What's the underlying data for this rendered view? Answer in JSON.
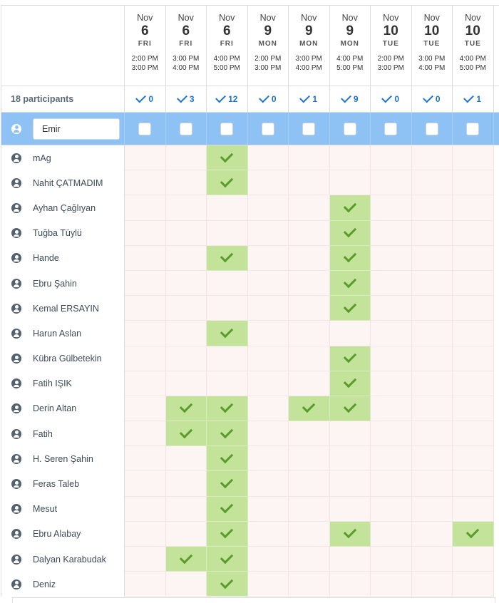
{
  "participants_label": "18 participants",
  "input": {
    "value": "Emir"
  },
  "slots": [
    {
      "month": "Nov",
      "day": "6",
      "dow": "FRI",
      "start": "2:00 PM",
      "end": "3:00 PM",
      "count": "0"
    },
    {
      "month": "Nov",
      "day": "6",
      "dow": "FRI",
      "start": "3:00 PM",
      "end": "4:00 PM",
      "count": "3"
    },
    {
      "month": "Nov",
      "day": "6",
      "dow": "FRI",
      "start": "4:00 PM",
      "end": "5:00 PM",
      "count": "12"
    },
    {
      "month": "Nov",
      "day": "9",
      "dow": "MON",
      "start": "2:00 PM",
      "end": "3:00 PM",
      "count": "0"
    },
    {
      "month": "Nov",
      "day": "9",
      "dow": "MON",
      "start": "3:00 PM",
      "end": "4:00 PM",
      "count": "1"
    },
    {
      "month": "Nov",
      "day": "9",
      "dow": "MON",
      "start": "4:00 PM",
      "end": "5:00 PM",
      "count": "9"
    },
    {
      "month": "Nov",
      "day": "10",
      "dow": "TUE",
      "start": "2:00 PM",
      "end": "3:00 PM",
      "count": "0"
    },
    {
      "month": "Nov",
      "day": "10",
      "dow": "TUE",
      "start": "3:00 PM",
      "end": "4:00 PM",
      "count": "0"
    },
    {
      "month": "Nov",
      "day": "10",
      "dow": "TUE",
      "start": "4:00 PM",
      "end": "5:00 PM",
      "count": "1"
    }
  ],
  "participants": [
    {
      "name": "mAg",
      "votes": [
        0,
        0,
        1,
        0,
        0,
        0,
        0,
        0,
        0
      ]
    },
    {
      "name": "Nahit ÇATMADIM",
      "votes": [
        0,
        0,
        1,
        0,
        0,
        0,
        0,
        0,
        0
      ]
    },
    {
      "name": "Ayhan Çağlıyan",
      "votes": [
        0,
        0,
        0,
        0,
        0,
        1,
        0,
        0,
        0
      ]
    },
    {
      "name": "Tuğba Tüylü",
      "votes": [
        0,
        0,
        0,
        0,
        0,
        1,
        0,
        0,
        0
      ]
    },
    {
      "name": "Hande",
      "votes": [
        0,
        0,
        1,
        0,
        0,
        1,
        0,
        0,
        0
      ]
    },
    {
      "name": "Ebru Şahin",
      "votes": [
        0,
        0,
        0,
        0,
        0,
        1,
        0,
        0,
        0
      ]
    },
    {
      "name": "Kemal ERSAYIN",
      "votes": [
        0,
        0,
        0,
        0,
        0,
        1,
        0,
        0,
        0
      ]
    },
    {
      "name": "Harun Aslan",
      "votes": [
        0,
        0,
        1,
        0,
        0,
        0,
        0,
        0,
        0
      ]
    },
    {
      "name": "Kübra Gülbetekin",
      "votes": [
        0,
        0,
        0,
        0,
        0,
        1,
        0,
        0,
        0
      ]
    },
    {
      "name": "Fatih IŞIK",
      "votes": [
        0,
        0,
        0,
        0,
        0,
        1,
        0,
        0,
        0
      ]
    },
    {
      "name": "Derin Altan",
      "votes": [
        0,
        1,
        1,
        0,
        1,
        1,
        0,
        0,
        0
      ]
    },
    {
      "name": "Fatih",
      "votes": [
        0,
        1,
        1,
        0,
        0,
        0,
        0,
        0,
        0
      ]
    },
    {
      "name": "H. Seren Şahin",
      "votes": [
        0,
        0,
        1,
        0,
        0,
        0,
        0,
        0,
        0
      ]
    },
    {
      "name": "Feras Taleb",
      "votes": [
        0,
        0,
        1,
        0,
        0,
        0,
        0,
        0,
        0
      ]
    },
    {
      "name": "Mesut",
      "votes": [
        0,
        0,
        1,
        0,
        0,
        0,
        0,
        0,
        0
      ]
    },
    {
      "name": "Ebru Alabay",
      "votes": [
        0,
        0,
        1,
        0,
        0,
        1,
        0,
        0,
        1
      ]
    },
    {
      "name": "Dalyan Karabudak",
      "votes": [
        0,
        1,
        1,
        0,
        0,
        0,
        0,
        0,
        0
      ]
    },
    {
      "name": "Deniz",
      "votes": [
        0,
        0,
        1,
        0,
        0,
        0,
        0,
        0,
        0
      ]
    }
  ],
  "colors": {
    "accent": "#1a73d9",
    "selected_row": "#8ec2f4",
    "yes_cell": "#c3e39b",
    "no_cell": "#fdf4f4",
    "check": "#5a9c2a"
  },
  "icons": {
    "participant": "user-circle-icon",
    "vote": "check-icon"
  }
}
